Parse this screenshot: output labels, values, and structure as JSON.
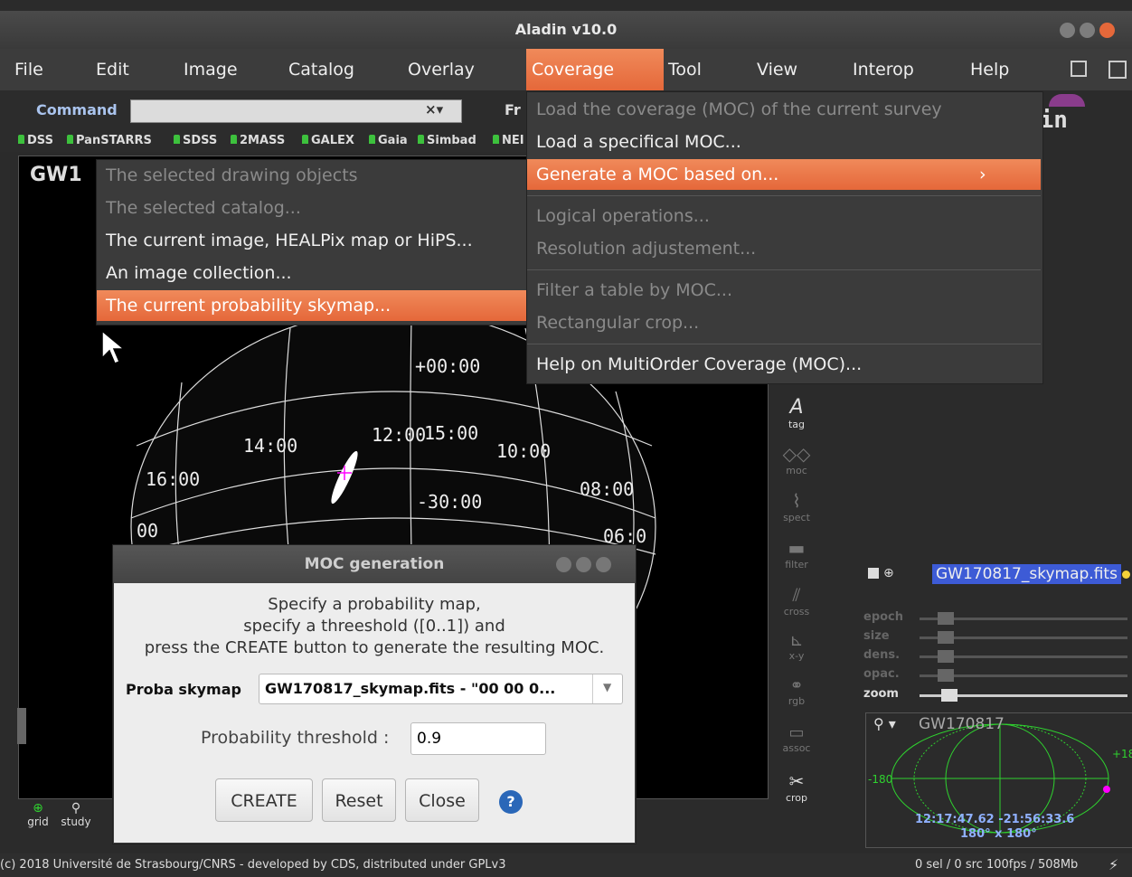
{
  "window": {
    "title": "Aladin v10.0"
  },
  "menubar": {
    "items": [
      "File",
      "Edit",
      "Image",
      "Catalog",
      "Overlay",
      "Coverage",
      "Tool",
      "View",
      "Interop",
      "Help"
    ],
    "active": "Coverage"
  },
  "command": {
    "label": "Command",
    "value": "",
    "frame_label": "Fr"
  },
  "hips_bookmarks": [
    "DSS",
    "PanSTARRS",
    "SDSS",
    "2MASS",
    "GALEX",
    "Gaia",
    "Simbad",
    "NEI"
  ],
  "view": {
    "title": "GW1",
    "grid_labels": [
      "+00:00",
      "14:00",
      "12:00",
      "15:00",
      "10:00",
      "16:00",
      "08:00",
      "-30:00",
      "06:0",
      "00"
    ]
  },
  "coverage_menu": {
    "items": [
      {
        "label": "Load the coverage (MOC) of the current survey",
        "enabled": false
      },
      {
        "label": "Load a specifical MOC...",
        "enabled": true
      },
      {
        "label": "Generate a MOC based on...",
        "enabled": true,
        "highlighted": true
      },
      {
        "label": "Logical operations...",
        "enabled": false
      },
      {
        "label": "Resolution adjustement...",
        "enabled": false
      },
      {
        "label": "Filter a table by MOC...",
        "enabled": false
      },
      {
        "label": "Rectangular crop...",
        "enabled": false
      },
      {
        "label": "Help on MultiOrder Coverage (MOC)...",
        "enabled": true
      }
    ],
    "submenu_arrow": "›"
  },
  "generate_submenu": {
    "items": [
      {
        "label": "The selected drawing objects",
        "enabled": false
      },
      {
        "label": "The selected catalog...",
        "enabled": false
      },
      {
        "label": "The current image, HEALPix map or HiPS...",
        "enabled": true
      },
      {
        "label": "An image collection...",
        "enabled": true
      },
      {
        "label": "The current probability skymap...",
        "enabled": true,
        "highlighted": true
      }
    ]
  },
  "tools": [
    {
      "label": "tag",
      "icon": "tag-icon"
    },
    {
      "label": "moc",
      "icon": "moc-icon"
    },
    {
      "label": "spect",
      "icon": "spectrum-icon"
    },
    {
      "label": "filter",
      "icon": "filter-icon"
    },
    {
      "label": "cross",
      "icon": "cross-icon"
    },
    {
      "label": "x-y",
      "icon": "xy-icon"
    },
    {
      "label": "rgb",
      "icon": "rgb-icon"
    },
    {
      "label": "assoc",
      "icon": "assoc-icon"
    },
    {
      "label": "crop",
      "icon": "scissors-icon"
    }
  ],
  "bottom_tools": [
    {
      "label": "grid",
      "icon": "globe-icon"
    },
    {
      "label": "study",
      "icon": "magnifier-icon"
    }
  ],
  "layer": {
    "name": "GW170817_skymap.fits"
  },
  "sliders": [
    {
      "label": "epoch"
    },
    {
      "label": "size"
    },
    {
      "label": "dens."
    },
    {
      "label": "opac."
    },
    {
      "label": "zoom"
    }
  ],
  "overview": {
    "target": "GW170817",
    "coord": "12:17:47.62 -21:56:33.6",
    "fov": "180° x 180°",
    "left_label": "-180",
    "right_label": "+18"
  },
  "dialog": {
    "title": "MOC generation",
    "instructions": [
      "Specify a probability map,",
      "specify a threeshold ([0..1]) and",
      "press the CREATE button to generate the resulting MOC."
    ],
    "skymap_label": "Proba skymap",
    "skymap_value": "GW170817_skymap.fits - \"00 00 0...",
    "threshold_label": "Probability threshold :",
    "threshold_value": "0.9",
    "buttons": {
      "create": "CREATE",
      "reset": "Reset",
      "close": "Close"
    },
    "help": "?"
  },
  "status": {
    "left": "(c) 2018 Université de Strasbourg/CNRS - developed by CDS, distributed under GPLv3",
    "right": "0 sel / 0 src   100fps / 508Mb"
  },
  "colors": {
    "accent": "#e86b3c",
    "layer_highlight": "#3d5bd6",
    "grid": "#2fd22f",
    "magenta": "#ff00ff"
  }
}
